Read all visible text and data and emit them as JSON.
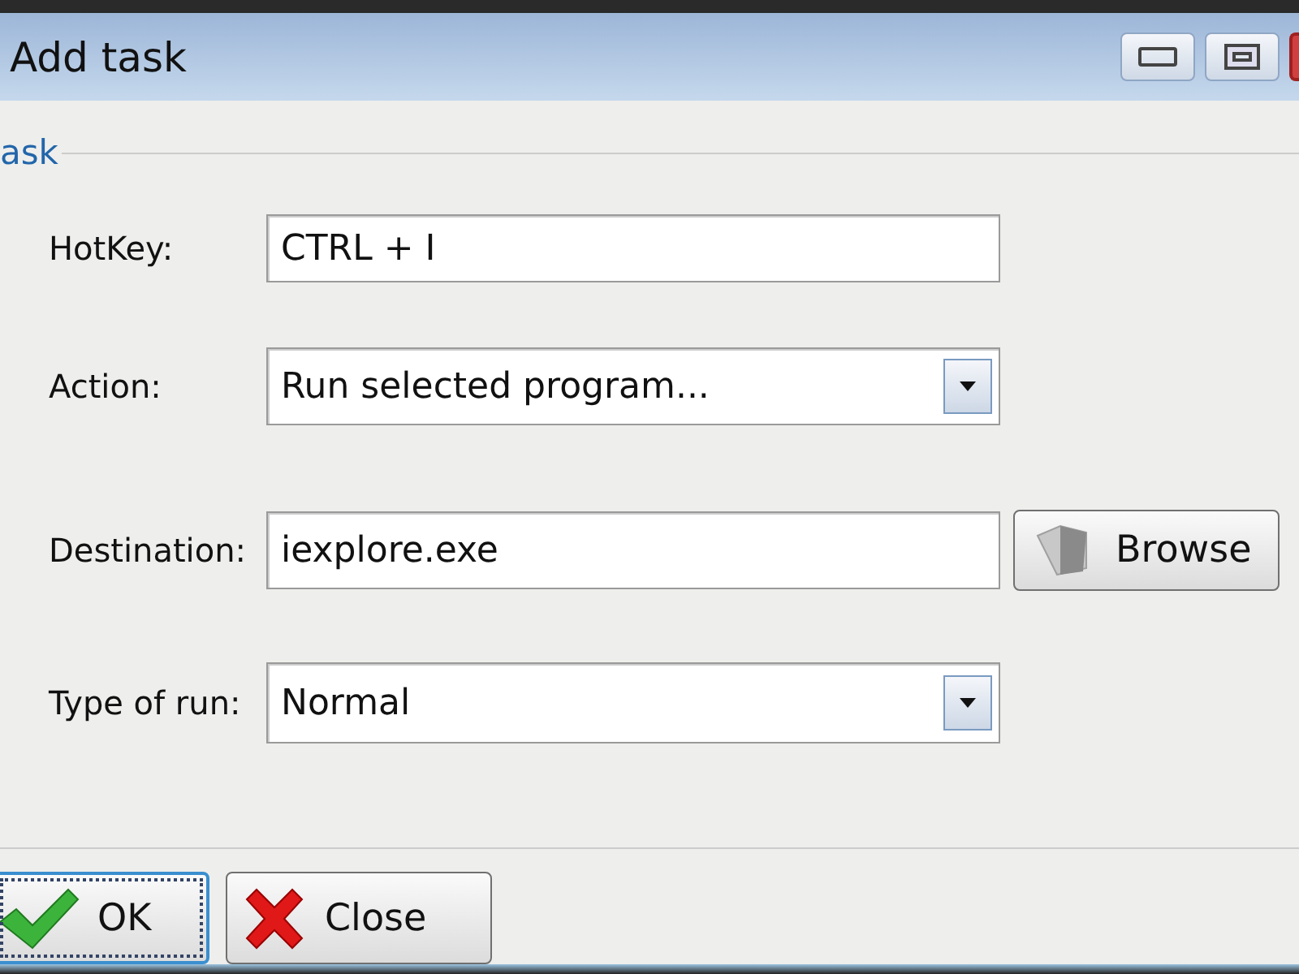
{
  "window": {
    "title": "Add task"
  },
  "group": {
    "title": "ask"
  },
  "fields": [
    {
      "kind": "text",
      "label": "HotKey:",
      "value": "CTRL + I"
    },
    {
      "kind": "dropdown",
      "label": "Action:",
      "value": "Run selected program..."
    },
    {
      "kind": "browse",
      "label": "Destination:",
      "value": "iexplore.exe",
      "button": "Browse"
    },
    {
      "kind": "dropdown",
      "label": "Type of run:",
      "value": "Normal"
    }
  ],
  "buttons": [
    {
      "kind": "ok",
      "label": "OK",
      "focused": true
    },
    {
      "kind": "close",
      "label": "Close",
      "focused": false
    }
  ]
}
